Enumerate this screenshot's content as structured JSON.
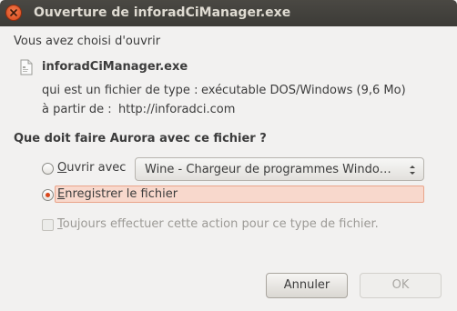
{
  "window": {
    "title": "Ouverture de inforadCiManager.exe"
  },
  "dialog": {
    "intro": "Vous avez choisi d'ouvrir",
    "file": {
      "icon": "file-icon",
      "name": "inforadCiManager.exe",
      "type_label": "qui est un fichier de type :",
      "type_value": "exécutable DOS/Windows (9,6 Mo)",
      "from_label": "à partir de :",
      "from_value": "http://inforadci.com"
    },
    "question": "Que doit faire Aurora avec ce fichier ?",
    "open_with": {
      "label_accesskey": "O",
      "label_rest": "uvrir avec",
      "selected": false,
      "app": "Wine - Chargeur de programmes Windo…"
    },
    "save_file": {
      "label_accesskey": "E",
      "label_rest": "nregistrer le fichier",
      "selected": true
    },
    "always": {
      "label_accesskey": "T",
      "label_rest": "oujours effectuer cette action pour ce type de fichier.",
      "checked": false,
      "enabled": false
    },
    "buttons": {
      "cancel": "Annuler",
      "ok": "OK"
    }
  },
  "colors": {
    "titlebar": "#3c3b37",
    "accent": "#d9471c",
    "highlight": "#f8d8cc"
  }
}
